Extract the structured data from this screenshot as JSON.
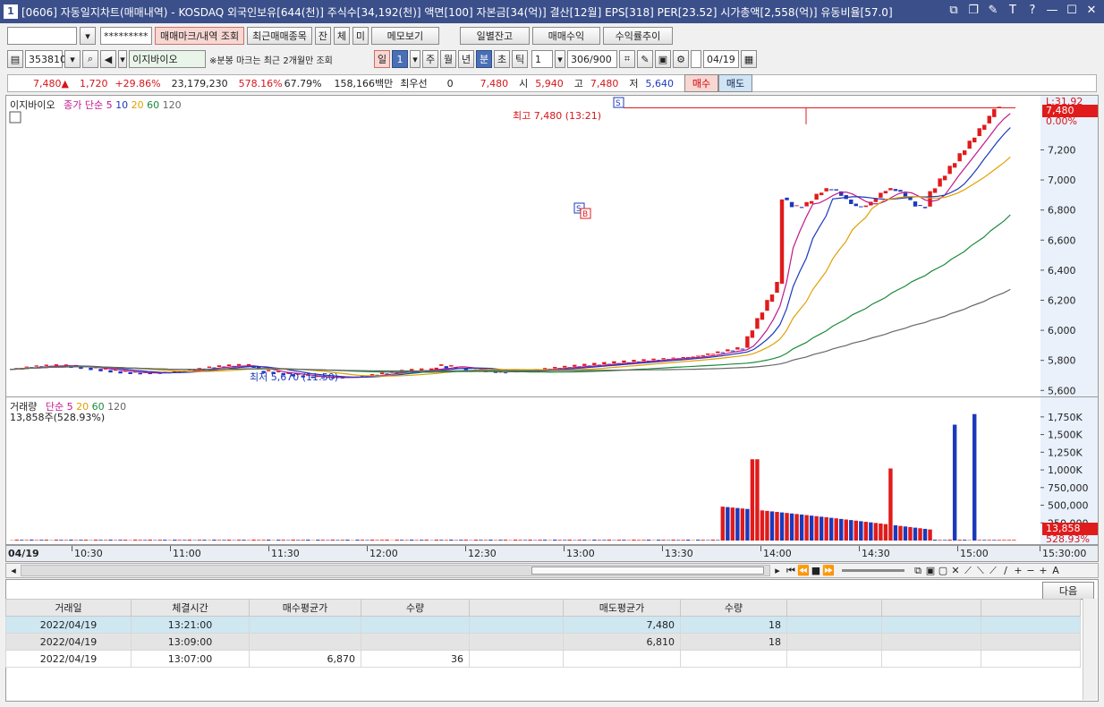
{
  "window": {
    "num": "1",
    "title": "[0606] 자동일지차트(매매내역) - KOSDAQ 외국인보유[644(천)] 주식수[34,192(천)] 액면[100] 자본금[34(억)] 결산[12월] EPS[318] PER[23.52] 시가총액[2,558(억)] 유동비율[57.0]",
    "controls": [
      "⧉",
      "❐",
      "✎",
      "T",
      "?",
      "—",
      "☐",
      "✕"
    ]
  },
  "toolbar1": {
    "account_value": "",
    "password_mask": "*********",
    "buttons": [
      "매매마크/내역 조회",
      "최근매매종목",
      "잔",
      "체",
      "미",
      "메모보기",
      "일별잔고",
      "매매수익",
      "수익률추이"
    ]
  },
  "toolbar2": {
    "code": "353810",
    "stock_name": "이지바이오",
    "note": "※분봉 마크는 최근 2개월만 조회",
    "period_buttons": [
      "일",
      "1",
      "주",
      "월",
      "년",
      "분",
      "초",
      "틱"
    ],
    "interval": "1",
    "count": "306/900",
    "date": "04/19"
  },
  "quote": {
    "price": "7,480",
    "arrow": "▲",
    "change": "1,720",
    "change_pct": "+29.86%",
    "volume": "23,179,230",
    "vol_ratio": "578.16%",
    "ratio2": "67.79%",
    "amount": "158,166백만",
    "preferred_label": "최우선",
    "preferred_val": "0",
    "ask": "7,480",
    "open_label": "시",
    "open": "5,940",
    "high_label": "고",
    "high": "7,480",
    "low_label": "저",
    "low": "5,640",
    "buy_btn": "매수",
    "sell_btn": "매도"
  },
  "price_chart": {
    "legend_name": "이지바이오",
    "legend_ma": "종가 단순",
    "ma_periods": [
      "5",
      "10",
      "20",
      "60",
      "120"
    ],
    "ma_colors": [
      "#c0188c",
      "#1c39bb",
      "#e0a000",
      "#1a8a3a",
      "#666666"
    ],
    "high_annotation": "최고 7,480 (13:21)",
    "low_annotation": "최저 5,670 (11:50)",
    "right_top_label": "L:31.92",
    "right_price_badge": "7,480",
    "right_pct": "0.00%"
  },
  "volume_chart": {
    "legend_name": "거래량",
    "legend_ma": "단순",
    "ma_periods": [
      "5",
      "20",
      "60",
      "120"
    ],
    "current": "13,858주(528.93%)",
    "right_badge": "13,858",
    "right_pct": "528.93%"
  },
  "chart_data": {
    "type": "candlestick",
    "price_axis": [
      "7,200",
      "7,000",
      "6,800",
      "6,600",
      "6,400",
      "6,200",
      "6,000",
      "5,800",
      "5,600"
    ],
    "volume_axis": [
      "1,750K",
      "1,500K",
      "1,250K",
      "1,000K",
      "750,000",
      "500,000",
      "250,000"
    ],
    "time_axis": [
      "10:30",
      "11:00",
      "11:30",
      "12:00",
      "12:30",
      "13:00",
      "13:30",
      "14:00",
      "14:30",
      "15:00",
      "15:30:00"
    ],
    "date_label": "04/19",
    "ylim": [
      5560,
      7560
    ]
  },
  "trade_table": {
    "next_btn": "다음",
    "headers": [
      "거래일",
      "체결시간",
      "매수평균가",
      "수량",
      "",
      "매도평균가",
      "수량",
      "",
      "",
      ""
    ],
    "rows": [
      [
        "2022/04/19",
        "13:21:00",
        "",
        "",
        "",
        "7,480",
        "18",
        "",
        "",
        ""
      ],
      [
        "2022/04/19",
        "13:09:00",
        "",
        "",
        "",
        "6,810",
        "18",
        "",
        "",
        ""
      ],
      [
        "2022/04/19",
        "13:07:00",
        "6,870",
        "36",
        "",
        "",
        "",
        "",
        "",
        ""
      ]
    ]
  }
}
